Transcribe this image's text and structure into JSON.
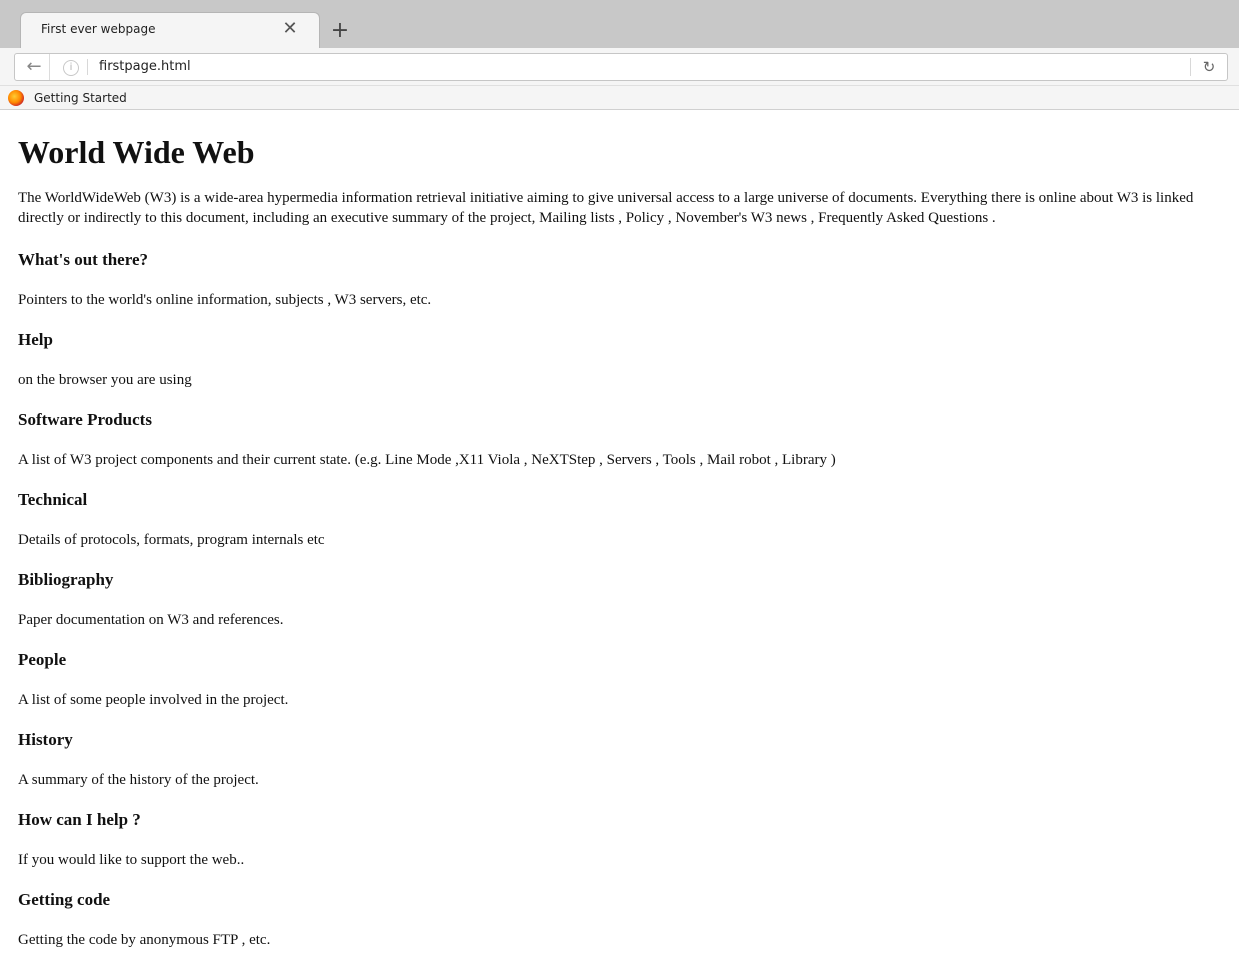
{
  "browser": {
    "tab_title": "First ever webpage",
    "close_glyph": "✕",
    "new_tab_glyph": "+",
    "back_glyph": "←",
    "info_glyph": "i",
    "url": "firstpage.html",
    "reload_glyph": "↻",
    "bookmark_label": "Getting Started"
  },
  "page": {
    "title": "World Wide Web",
    "intro": "The WorldWideWeb (W3) is a wide-area hypermedia information retrieval initiative aiming to give universal access to a large universe of documents. Everything there is online about W3 is linked directly or indirectly to this document, including an executive summary of the project, Mailing lists , Policy , November's W3 news , Frequently Asked Questions .",
    "sections": [
      {
        "heading": "What's out there?",
        "text": "Pointers to the world's online information, subjects , W3 servers, etc."
      },
      {
        "heading": "Help",
        "text": "on the browser you are using"
      },
      {
        "heading": "Software Products",
        "text": "A list of W3 project components and their current state. (e.g. Line Mode ,X11 Viola , NeXTStep , Servers , Tools , Mail robot , Library )"
      },
      {
        "heading": "Technical",
        "text": "Details of protocols, formats, program internals etc"
      },
      {
        "heading": "Bibliography",
        "text": "Paper documentation on W3 and references."
      },
      {
        "heading": "People",
        "text": "A list of some people involved in the project."
      },
      {
        "heading": "History",
        "text": "A summary of the history of the project."
      },
      {
        "heading": "How can I help ?",
        "text": "If you would like to support the web.."
      },
      {
        "heading": "Getting code",
        "text": "Getting the code by anonymous FTP , etc."
      }
    ]
  }
}
